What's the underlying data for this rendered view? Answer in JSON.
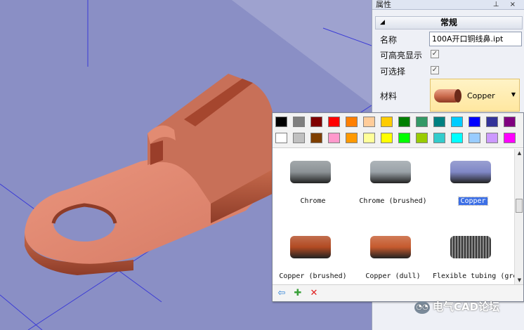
{
  "properties_panel": {
    "title": "属性",
    "title_buttons": "⊥ ×",
    "section": "常规",
    "rows": [
      {
        "label": "名称",
        "value": "100A开口铜线鼻.ipt"
      },
      {
        "label": "可高亮显示",
        "checked": true
      },
      {
        "label": "可选择",
        "checked": true
      },
      {
        "label": "材料",
        "value": "Copper"
      }
    ]
  },
  "material_popup": {
    "palette_row1": [
      "#000000",
      "#7f7f7f",
      "#7f0000",
      "#ff0000",
      "#ff7f00",
      "#ffcc99",
      "#ffcc00",
      "#007f00",
      "#339966",
      "#008080",
      "#00ccff",
      "#0000ff",
      "#333399",
      "#800080"
    ],
    "palette_row2": [
      "#ffffff",
      "#c0c0c0",
      "#7f3f00",
      "#ff99cc",
      "#ff9900",
      "#ffff99",
      "#ffff00",
      "#00ff00",
      "#99cc00",
      "#33cccc",
      "#00ffff",
      "#99ccff",
      "#cc99ff",
      "#ff00ff"
    ],
    "materials": [
      {
        "name": "Chrome",
        "color": "#8c9296",
        "selected": false
      },
      {
        "name": "Chrome (brushed)",
        "color": "#9aa2a8",
        "selected": false
      },
      {
        "name": "Copper",
        "color": "#8088c6",
        "selected": true
      },
      {
        "name": "Copper (brushed)",
        "color": "#b24a22",
        "selected": false
      },
      {
        "name": "Copper (dull)",
        "color": "#c55a2e",
        "selected": false
      },
      {
        "name": "Flexible tubing (grey)",
        "color": "#5c5c5c",
        "selected": false
      }
    ],
    "toolbar_icons": [
      "import-icon",
      "add-material-icon",
      "delete-icon"
    ]
  },
  "watermark": "电气CAD论坛"
}
